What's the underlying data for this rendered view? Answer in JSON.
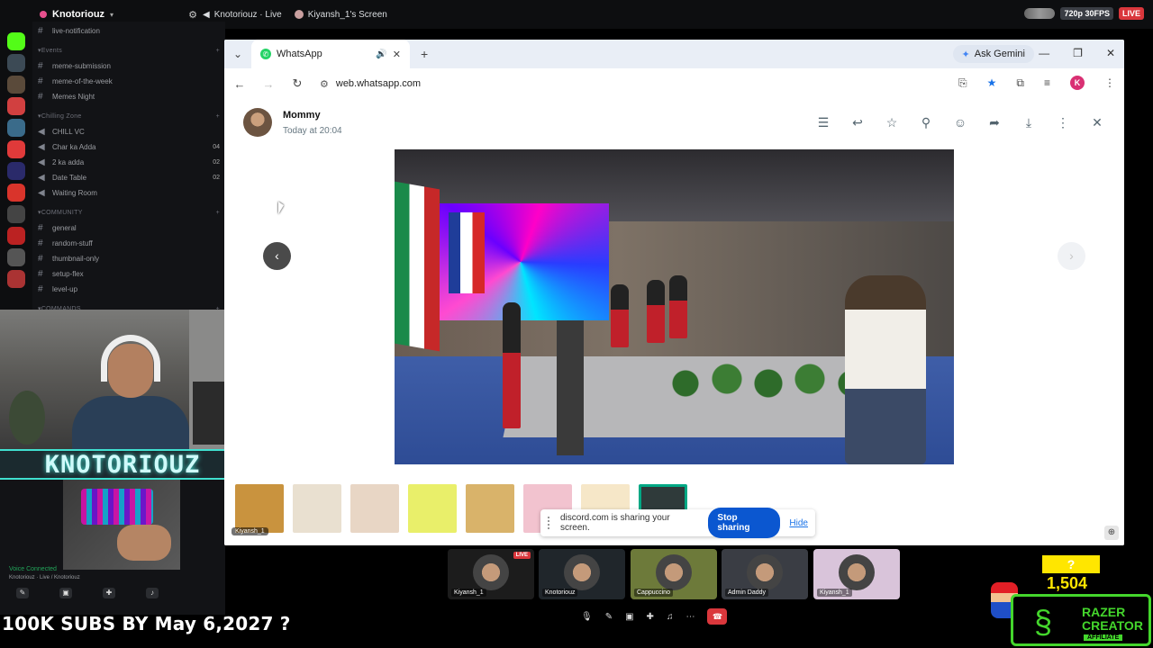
{
  "discord": {
    "server_name": "Knotoriouz",
    "topbar_stream": "Knotoriouz · Live",
    "topbar_screen": "Kiyansh_1's Screen",
    "quality": "720p 30FPS",
    "live": "LIVE",
    "channels": [
      {
        "type": "text",
        "name": "live-notification",
        "icon": "bell-icon"
      },
      {
        "type": "category",
        "name": "Events"
      },
      {
        "type": "text",
        "name": "meme-submission"
      },
      {
        "type": "text",
        "name": "meme-of-the-week"
      },
      {
        "type": "text",
        "name": "Memes Night"
      },
      {
        "type": "category",
        "name": "Chilling Zone"
      },
      {
        "type": "voice",
        "name": "CHILL VC"
      },
      {
        "type": "voice",
        "name": "Char ka Adda",
        "count": "04"
      },
      {
        "type": "voice",
        "name": "2 ka adda",
        "count": "02"
      },
      {
        "type": "voice",
        "name": "Date Table",
        "count": "02"
      },
      {
        "type": "voice",
        "name": "Waiting Room"
      },
      {
        "type": "category",
        "name": "COMMUNITY"
      },
      {
        "type": "text",
        "name": "general"
      },
      {
        "type": "text",
        "name": "random-stuff"
      },
      {
        "type": "text",
        "name": "thumbnail-only"
      },
      {
        "type": "text",
        "name": "setup-flex"
      },
      {
        "type": "text",
        "name": "level-up"
      },
      {
        "type": "category",
        "name": "COMMANDS"
      }
    ],
    "voice_connected": "Voice Connected",
    "voice_channel": "Knotoriouz · Live / Knotoriouz",
    "tiles": [
      {
        "label": "Kiyansh_1",
        "live": "LIVE",
        "color": "#1c1c1c"
      },
      {
        "label": "Knotoriouz",
        "color": "#20262b"
      },
      {
        "label": "Cappuccino",
        "color": "#6d7a3a"
      },
      {
        "label": "Admin Daddy",
        "color": "#3a3d44"
      },
      {
        "label": "Kiyansh_1",
        "color": "#d9c4da"
      }
    ]
  },
  "overlay": {
    "banner": "KNOTORIOUZ",
    "subs_goal": "100K SUBS BY May 6,2027 ?",
    "goal_box": "?",
    "goal_number": "1,504",
    "razer_line1": "RAZER",
    "razer_line2": "CREATOR",
    "razer_line3": "AFFILIATE"
  },
  "browser": {
    "tab_title": "WhatsApp",
    "ask_gemini": "Ask Gemini",
    "url": "web.whatsapp.com",
    "profile_initial": "K"
  },
  "viewer": {
    "contact_name": "Mommy",
    "timestamp": "Today at 20:04",
    "thumbnail_sender": "Kiyansh_1",
    "thumbnails": [
      {
        "color": "#c9933e"
      },
      {
        "color": "#e9e0d0"
      },
      {
        "color": "#e8d6c5"
      },
      {
        "color": "#e9ef6a"
      },
      {
        "color": "#d9b36a"
      },
      {
        "color": "#f2c3cf"
      },
      {
        "color": "#f6e7c8"
      },
      {
        "color": "#2f3a3a"
      }
    ]
  },
  "share_notice": {
    "text": "discord.com is sharing your screen.",
    "stop": "Stop sharing",
    "hide": "Hide"
  },
  "colors": {
    "discord_bg": "#121316",
    "whatsapp_green": "#25d366",
    "chrome_blue": "#0b57d0",
    "razer_green": "#44d62c"
  }
}
